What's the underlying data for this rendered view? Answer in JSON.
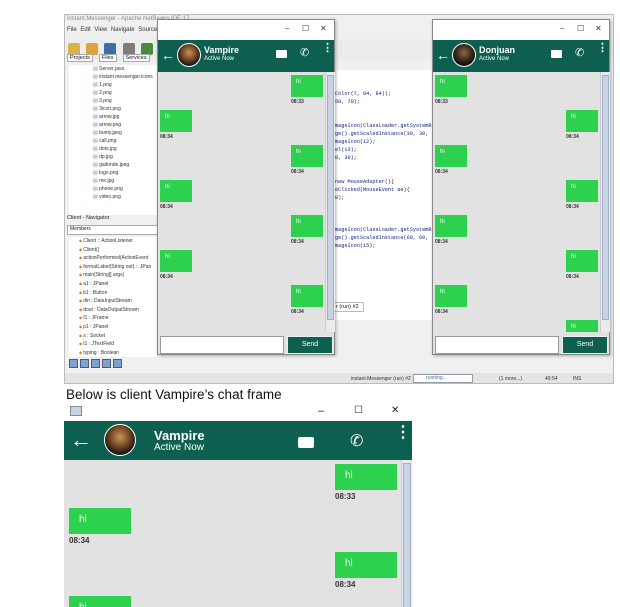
{
  "ide": {
    "title": "instant.Messenger - Apache NetBeans IDE 17",
    "menu": "File  Edit  View  Navigate  Source  R",
    "tabs": [
      "Projects",
      "Files",
      "Services"
    ],
    "files": [
      "Server.java",
      "instant.messenger.icons",
      "1.png",
      "2.png",
      "3.png",
      "3icon.png",
      "arrow.jpg",
      "arrow.png",
      "bunty.jpeg",
      "call.png",
      "dots.jpg",
      "dp.jpg",
      "gaitonde.jpeg",
      "logo.png",
      "me.jpg",
      "phone.png",
      "video.png"
    ],
    "navigator_title": "Client - Navigator",
    "members_label": "Members",
    "members": [
      "Client :: ActionListener",
      "Client()",
      "actionPerformed(ActionEvent",
      "formatLabel(String out) :: JPan",
      "main(String[] args)",
      "a1 : JPanel",
      "b1 : Button",
      "din : DataInputStream",
      "dout : DataOutputStream",
      "f1 : JFrame",
      "p1 : JPanel",
      "s : Socket",
      "t1 : JTextField",
      "typing : Boolean"
    ],
    "code_lines": [
      "Color(7, 94, 84));",
      "50, 70);",
      "",
      "",
      "mageIcon(ClassLoader.getSystemR",
      "ge().getScaledInstance(30, 30,",
      "mageIcon(i2);",
      "el(i3);",
      "0, 30);",
      "",
      "",
      "new MouseAdapter(){",
      "eClicked(MouseEvent ae){",
      "0);",
      "",
      "",
      "",
      "mageIcon(ClassLoader.getSystemR",
      "ge().getScaledInstance(60, 60,",
      "mageIcon(i5);"
    ],
    "output_tab": "r (run) #2",
    "status_task": "instant.Messenger (run) #2",
    "status_progress": "running...",
    "status_more": "(1 more...)",
    "status_pos": "49:54",
    "status_mode": "INS"
  },
  "vampire_small": {
    "name": "Vampire",
    "status": "Active Now",
    "messages": [
      {
        "text": "hi",
        "time": "08:33",
        "side": "right"
      },
      {
        "text": "hi",
        "time": "08:34",
        "side": "left"
      },
      {
        "text": "hi",
        "time": "08:34",
        "side": "right"
      },
      {
        "text": "hi",
        "time": "08:34",
        "side": "left"
      },
      {
        "text": "hi",
        "time": "08:34",
        "side": "right"
      },
      {
        "text": "hi",
        "time": "08:34",
        "side": "left"
      },
      {
        "text": "hi",
        "time": "08:34",
        "side": "right"
      }
    ],
    "send_label": "Send",
    "controls": [
      "–",
      "☐",
      "✕"
    ]
  },
  "donjuan": {
    "name": "Donjuan",
    "status": "Active Now",
    "messages": [
      {
        "text": "hi",
        "time": "08:33",
        "side": "left"
      },
      {
        "text": "hi",
        "time": "08:34",
        "side": "right"
      },
      {
        "text": "hi",
        "time": "08:34",
        "side": "left"
      },
      {
        "text": "hi",
        "time": "08:34",
        "side": "right"
      },
      {
        "text": "hi",
        "time": "08:34",
        "side": "left"
      },
      {
        "text": "hi",
        "time": "08:34",
        "side": "right"
      },
      {
        "text": "hi",
        "time": "08:34",
        "side": "left"
      },
      {
        "text": "hi",
        "time": "",
        "side": "right"
      }
    ],
    "send_label": "Send",
    "controls": [
      "–",
      "☐",
      "✕"
    ]
  },
  "caption": "Below is client Vampire’s chat frame",
  "vampire_large": {
    "name": "Vampire",
    "status": "Active Now",
    "messages": [
      {
        "text": "hi",
        "time": "08:33",
        "side": "right"
      },
      {
        "text": "hi",
        "time": "08:34",
        "side": "left"
      },
      {
        "text": "hi",
        "time": "08:34",
        "side": "right"
      },
      {
        "text": "hi",
        "time": "",
        "side": "left"
      }
    ],
    "controls": [
      "–",
      "☐",
      "✕"
    ]
  },
  "colors": {
    "header": "#0d6050",
    "bubble": "#2dd14e",
    "body": "#e2e2e2"
  },
  "icons": [
    "back-arrow-icon",
    "video-call-icon",
    "phone-icon",
    "menu-dots-icon"
  ]
}
